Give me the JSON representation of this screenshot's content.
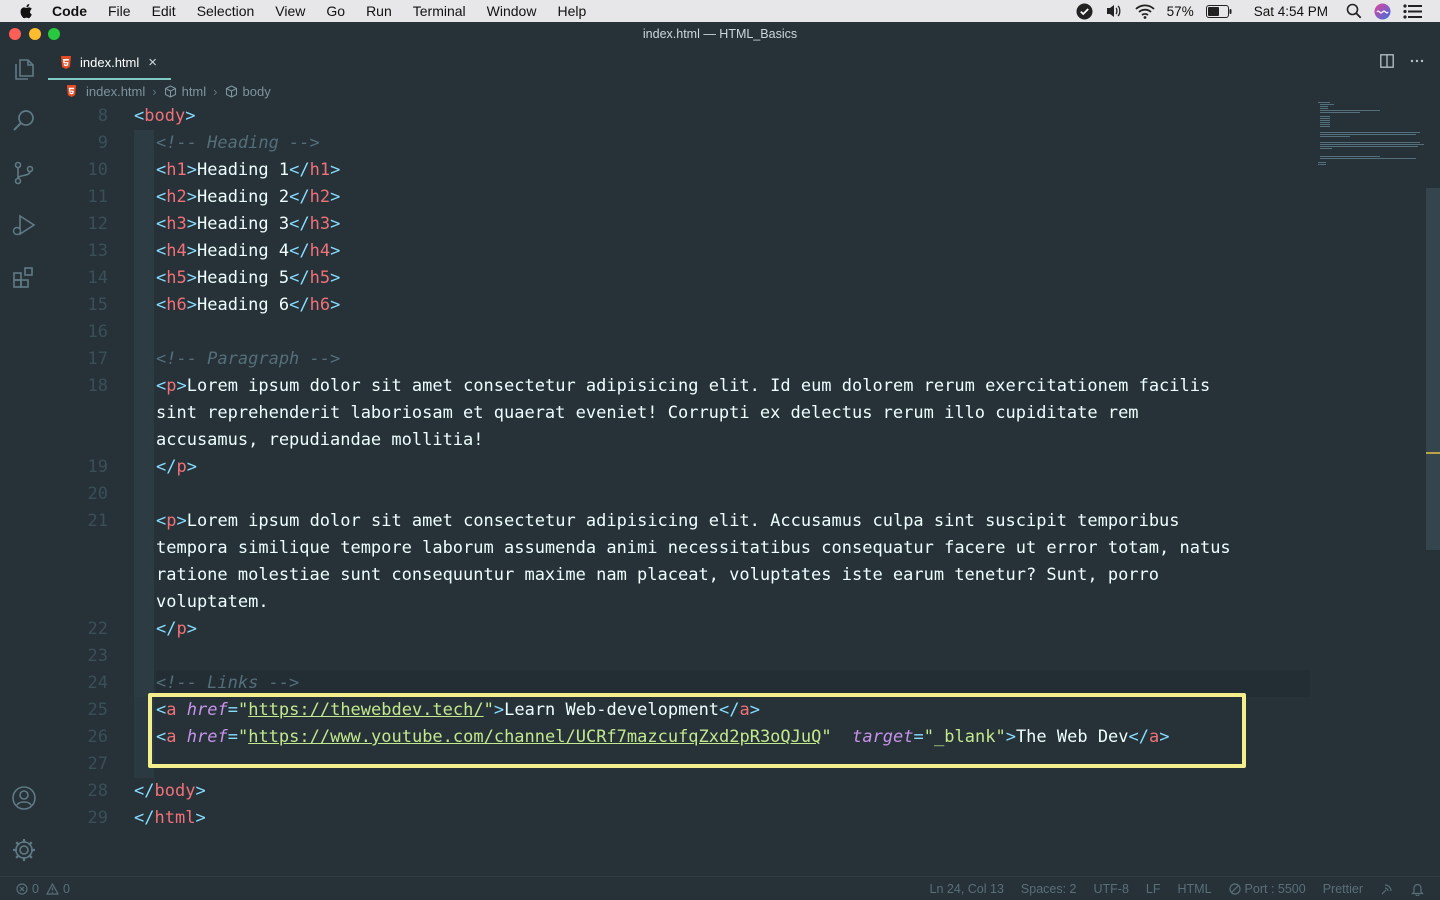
{
  "menubar": {
    "app_name": "Code",
    "items": [
      "File",
      "Edit",
      "Selection",
      "View",
      "Go",
      "Run",
      "Terminal",
      "Window",
      "Help"
    ],
    "battery": "57%",
    "clock": "Sat 4:54 PM"
  },
  "window": {
    "title": "index.html — HTML_Basics"
  },
  "tab": {
    "label": "index.html",
    "close": "×"
  },
  "breadcrumb": {
    "file": "index.html",
    "html": "html",
    "body": "body"
  },
  "editor": {
    "line_numbers": [
      "8",
      "9",
      "10",
      "11",
      "12",
      "13",
      "14",
      "15",
      "16",
      "17",
      "18",
      "19",
      "20",
      "21",
      "22",
      "23",
      "24",
      "25",
      "26",
      "27",
      "28",
      "29"
    ],
    "heading_comment": "<!-- Heading -->",
    "headings": [
      {
        "tag": "h1",
        "text": "Heading 1"
      },
      {
        "tag": "h2",
        "text": "Heading 2"
      },
      {
        "tag": "h3",
        "text": "Heading 3"
      },
      {
        "tag": "h4",
        "text": "Heading 4"
      },
      {
        "tag": "h5",
        "text": "Heading 5"
      },
      {
        "tag": "h6",
        "text": "Heading 6"
      }
    ],
    "paragraph_comment": "<!-- Paragraph -->",
    "p1_lines": [
      "Lorem ipsum dolor sit amet consectetur adipisicing elit. Id eum dolorem rerum exercitationem facilis",
      "sint reprehenderit laboriosam et quaerat eveniet! Corrupti ex delectus rerum illo cupiditate rem",
      "accusamus, repudiandae mollitia!"
    ],
    "p2_lines": [
      "Lorem ipsum dolor sit amet consectetur adipisicing elit. Accusamus culpa sint suscipit temporibus",
      "tempora similique tempore laborum assumenda animi necessitatibus consequatur facere ut error totam, natus",
      "ratione molestiae sunt consequuntur maxime nam placeat, voluptates iste earum tenetur? Sunt, porro",
      "voluptatem."
    ],
    "links_comment": "<!-- Links -->",
    "link1": {
      "href": "https://thewebdev.tech/",
      "text": "Learn Web-development"
    },
    "link2": {
      "href": "https://www.youtube.com/channel/UCRf7mazcufqZxd2pR3oQJuQ",
      "target": "_blank",
      "text": "The Web Dev"
    }
  },
  "statusbar": {
    "errors": "0",
    "warnings": "0",
    "position": "Ln 24, Col 13",
    "spaces": "Spaces: 2",
    "encoding": "UTF-8",
    "eol": "LF",
    "language": "HTML",
    "port": "Port : 5500",
    "formatter": "Prettier"
  },
  "colors": {
    "background": "#263238",
    "bracket": "#89ddff",
    "tag": "#f07178",
    "comment": "#546e7a",
    "attribute": "#c792ea",
    "string": "#c3e88d",
    "highlight_box": "#f4ee8c"
  },
  "icons": [
    "apple-icon",
    "explorer-icon",
    "search-icon",
    "source-control-icon",
    "run-debug-icon",
    "extensions-icon",
    "accounts-icon",
    "manage-gear-icon",
    "html5-file-icon",
    "split-editor-icon",
    "more-actions-icon",
    "error-icon",
    "warning-icon",
    "broadcast-icon",
    "bell-icon"
  ]
}
